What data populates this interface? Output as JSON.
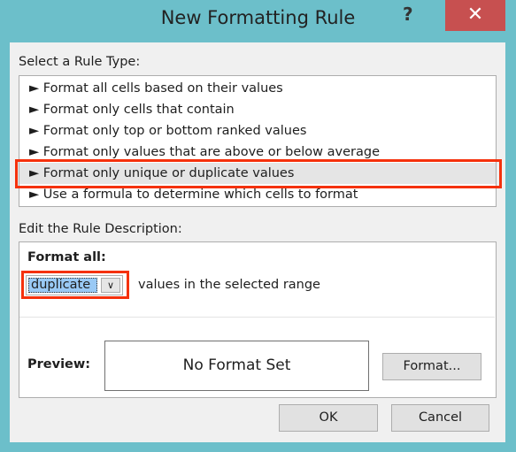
{
  "window": {
    "title": "New Formatting Rule",
    "help": "?",
    "close": "✕"
  },
  "rule_type": {
    "label": "Select a Rule Type:",
    "items": [
      "► Format all cells based on their values",
      "► Format only cells that contain",
      "► Format only top or bottom ranked values",
      "► Format only values that are above or below average",
      "► Format only unique or duplicate values",
      "► Use a formula to determine which cells to format"
    ],
    "selected_index": 4
  },
  "description": {
    "label": "Edit the Rule Description:",
    "format_all": "Format all:",
    "dropdown_value": "duplicate",
    "suffix": "values in the selected range",
    "preview_label": "Preview:",
    "preview_text": "No Format Set",
    "format_button": "Format..."
  },
  "buttons": {
    "ok": "OK",
    "cancel": "Cancel"
  },
  "colors": {
    "frame": "#6cbfca",
    "close": "#c75050",
    "highlight": "#f5310c",
    "selection": "#99c9f5"
  }
}
